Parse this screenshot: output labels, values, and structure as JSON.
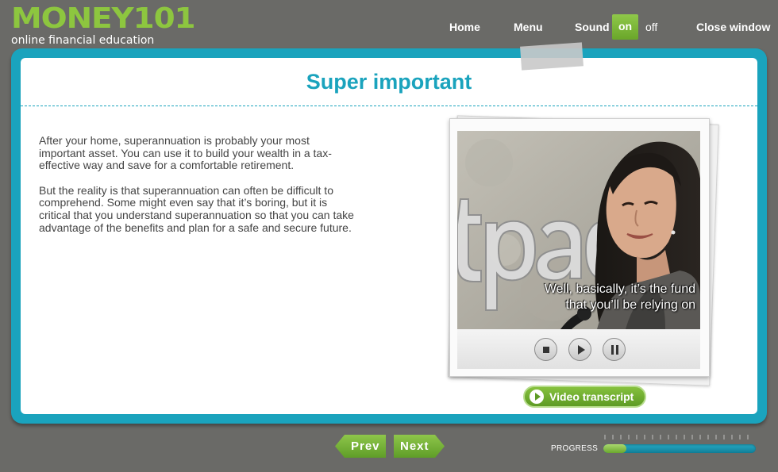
{
  "brand": {
    "title": "MONEY101",
    "subtitle": "online financial education"
  },
  "nav": {
    "home": "Home",
    "menu": "Menu",
    "sound_label": "Sound",
    "sound_on": "on",
    "sound_off": "off",
    "close": "Close window"
  },
  "page": {
    "title": "Super important",
    "paragraphs": [
      "After your home, superannuation is probably your most important asset. You can use it to build your wealth in a tax-effective way and save for a comfortable retirement.",
      "But the reality is that superannuation can often be difficult to comprehend. Some might even say that it’s boring, but it is critical that you understand superannuation so that you can take advantage of the benefits and plan for a safe and secure future."
    ]
  },
  "video": {
    "caption_line1": "Well, basically, it’s the fund",
    "caption_line2": "that you’ll be relying on",
    "controls": [
      "stop",
      "play",
      "pause"
    ],
    "transcript_label": "Video transcript"
  },
  "footer": {
    "prev_label": "Prev",
    "next_label": "Next",
    "progress_label": "PROGRESS",
    "progress_fraction": 0.15
  },
  "colors": {
    "brand_green": "#8dc63f",
    "accent_teal": "#1aa3bd",
    "background": "#6a6a67"
  }
}
